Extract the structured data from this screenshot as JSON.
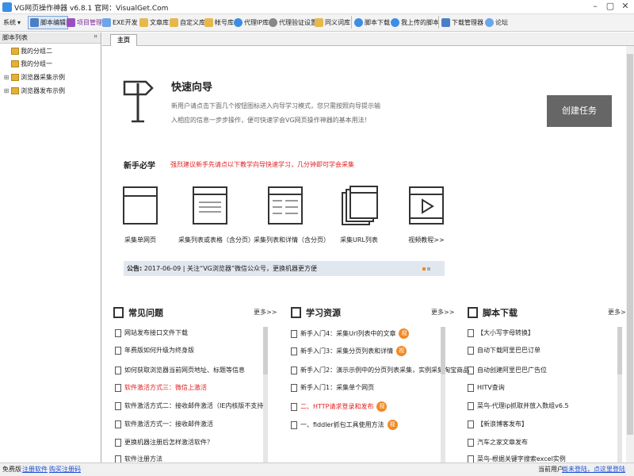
{
  "window": {
    "title": "VG网页操作神器 v6.8.1   官网：VisualGet.Com"
  },
  "toolbar": {
    "system": "系统",
    "script_edit": "脚本编辑",
    "project_mgmt": "项目管理",
    "exe_dev": "EXE开发",
    "text_lib": "文章库",
    "custom_lib": "自定义库",
    "account_lib": "帐号库",
    "proxy_ip": "代理IP库",
    "proxy_verify": "代理验证设置",
    "synonym_lib": "同义词库",
    "script_download": "脚本下载",
    "my_uploaded": "我上传的脚本",
    "download_manager": "下载管理器",
    "forum": "论坛"
  },
  "left_panel": {
    "title": "脚本列表",
    "items": [
      "我的分组二",
      "我的分组一",
      "浏览器采集示例",
      "浏览器发布示例"
    ]
  },
  "tabs": [
    {
      "label": "主页"
    }
  ],
  "guide": {
    "title": "快速向导",
    "desc": "新用户请点击下面几个按钮图标进入向导学习模式，您只需按照向导提示输入相应的信息一步步操作，便可快速学会VG网页操作神器的基本用法！",
    "create_button": "创建任务"
  },
  "newbie": {
    "title": "新手必学",
    "note": "强烈建议新手先请点以下教学向导快速学习，几分钟即可学会采集",
    "features": [
      "采集单网页",
      "采集列表或表格（含分页）",
      "采集列表和详情（含分页）",
      "采集URL列表",
      "视频教程>>"
    ]
  },
  "notice": {
    "label": "公告:",
    "date": "2017-06-09",
    "text": "关注“VG浏览器”微信公众号，更换机器更方便"
  },
  "sections": {
    "faq": {
      "title": "常见问题",
      "more": "更多>>",
      "items": [
        {
          "text": "网站发布接口文件下载",
          "red": false
        },
        {
          "text": "年费版如何升级为终身版",
          "red": false
        },
        {
          "text": "如何获取浏览器当前网页地址、标题等信息",
          "red": false
        },
        {
          "text": "软件激活方式三：微信上激活",
          "red": true
        },
        {
          "text": "软件激活方式二：接收邮件激活（IE内核版不支持）",
          "red": false
        },
        {
          "text": "软件激活方式一：接收邮件激活",
          "red": false
        },
        {
          "text": "更换机器注册后怎样激活软件？",
          "red": false
        },
        {
          "text": "软件注册方法",
          "red": false
        }
      ]
    },
    "learn": {
      "title": "学习资源",
      "more": "更多>>",
      "badge": "视",
      "items": [
        {
          "text": "新手入门4：采集Url列表中的文章",
          "red": false,
          "badge": true
        },
        {
          "text": "新手入门3：采集分页列表和详情",
          "red": false,
          "badge": true
        },
        {
          "text": "新手入门2：演示示例中的分页列表采集，实例采集淘宝商品",
          "red": false,
          "badge": false
        },
        {
          "text": "新手入门1：采集单个网页",
          "red": false,
          "badge": false
        },
        {
          "text": "二、HTTP请求登录和发布",
          "red": true,
          "badge": true
        },
        {
          "text": "一、fiddler抓包工具使用方法",
          "red": false,
          "badge": true
        }
      ]
    },
    "scripts": {
      "title": "脚本下载",
      "more": "更多>>",
      "items": [
        {
          "text": "【大小写字母转换】"
        },
        {
          "text": "自动下载阿里巴巴订单"
        },
        {
          "text": "自动创建阿里巴巴广告位"
        },
        {
          "text": "HITV查询"
        },
        {
          "text": "菜鸟-代理ip抓取并放入数组v6.5"
        },
        {
          "text": "【新浪博客发布】"
        },
        {
          "text": "汽车之家文章发布"
        },
        {
          "text": "菜鸟-根据关键字搜索excel实例"
        }
      ]
    }
  },
  "status": {
    "edition": "免费版",
    "register": "注册软件",
    "buy": "购买注册码",
    "current_user_label": "当前用户：",
    "login": "尚未登陆，点这里登陆"
  }
}
